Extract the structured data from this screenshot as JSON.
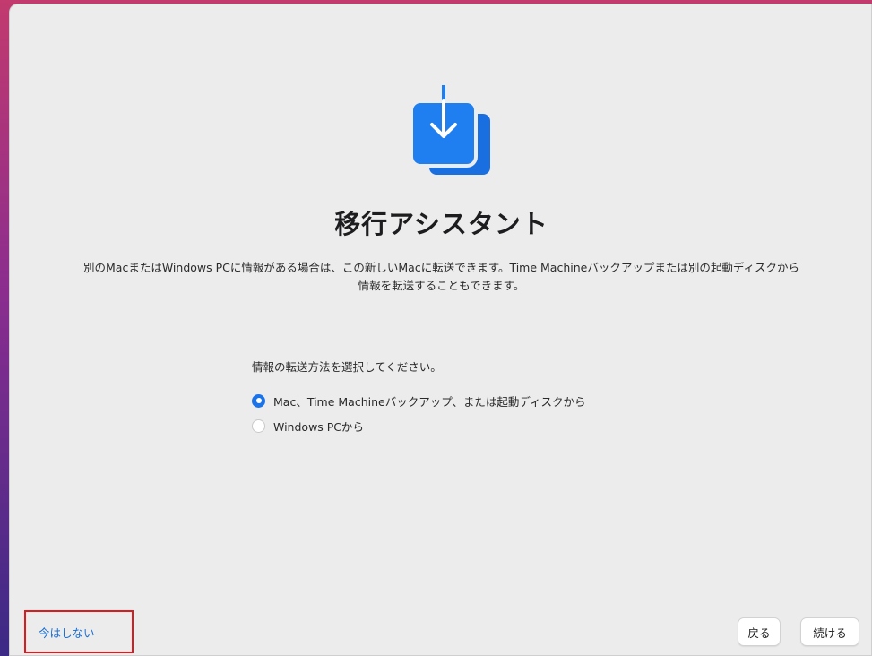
{
  "window": {
    "title": "移行アシスタント",
    "description": "別のMacまたはWindows PCに情報がある場合は、この新しいMacに転送できます。Time Machineバックアップまたは別の起動ディスクから情報を転送することもできます。"
  },
  "transfer": {
    "prompt": "情報の転送方法を選択してください。",
    "options": [
      {
        "label": "Mac、Time Machineバックアップ、または起動ディスクから",
        "selected": true
      },
      {
        "label": "Windows PCから",
        "selected": false
      }
    ]
  },
  "footer": {
    "not_now_label": "今はしない",
    "back_label": "戻る",
    "continue_label": "続ける"
  },
  "colors": {
    "accent": "#1a73e8",
    "link": "#1a6fd6",
    "highlight_box": "#e0191e"
  },
  "icons": {
    "app": "migration-assistant-icon"
  }
}
